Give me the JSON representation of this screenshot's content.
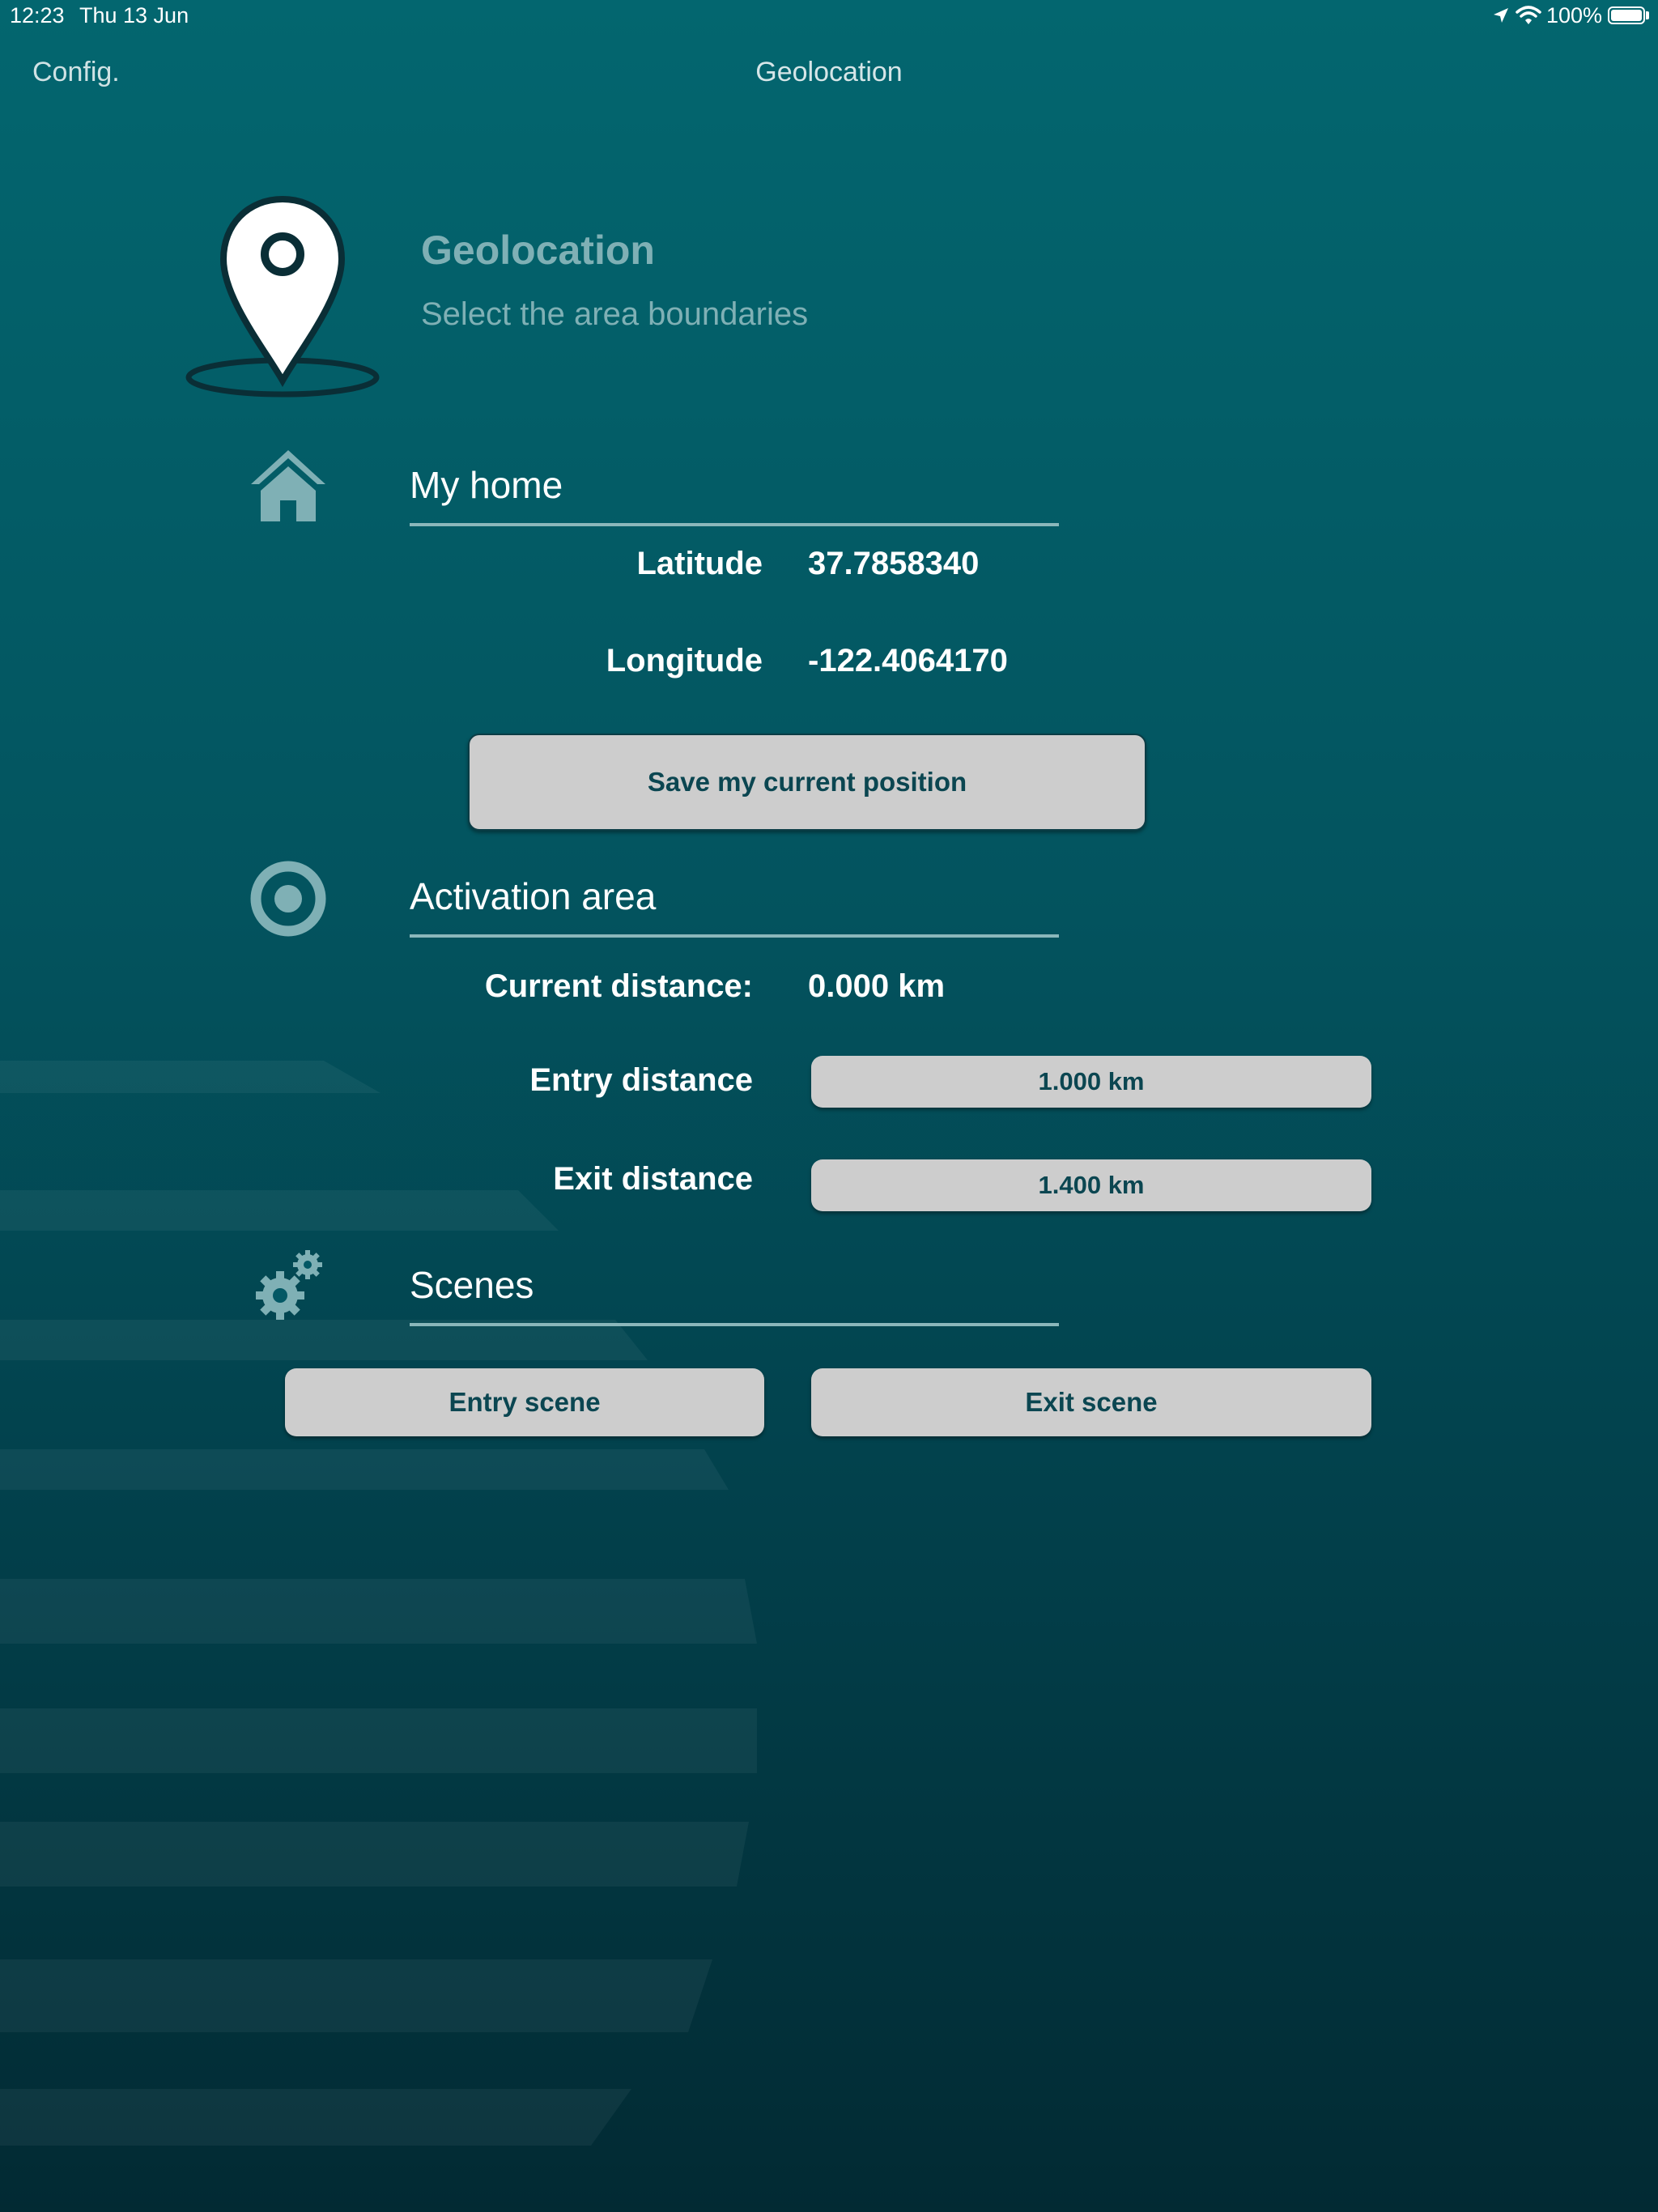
{
  "status_bar": {
    "time": "12:23",
    "date": "Thu 13 Jun",
    "battery": "100%"
  },
  "nav": {
    "back_label": "Config.",
    "title": "Geolocation"
  },
  "header": {
    "title": "Geolocation",
    "subtitle": "Select the area boundaries",
    "icon": "map-pin-icon"
  },
  "home": {
    "title": "My home",
    "icon": "house-icon",
    "latitude_label": "Latitude",
    "latitude_value": "37.7858340",
    "longitude_label": "Longitude",
    "longitude_value": "-122.4064170",
    "save_button_label": "Save my current position"
  },
  "activation": {
    "title": "Activation area",
    "icon": "target-icon",
    "current_label": "Current distance:",
    "current_value": "0.000 km",
    "entry_label": "Entry distance",
    "entry_value": "1.000 km",
    "exit_label": "Exit distance",
    "exit_value": "1.400 km"
  },
  "scenes": {
    "title": "Scenes",
    "icon": "gears-icon",
    "entry_button_label": "Entry scene",
    "exit_button_label": "Exit scene"
  },
  "colors": {
    "accent_text": "#7fb0b5",
    "button_bg": "#cdcdcd",
    "button_text": "#0b4651"
  }
}
